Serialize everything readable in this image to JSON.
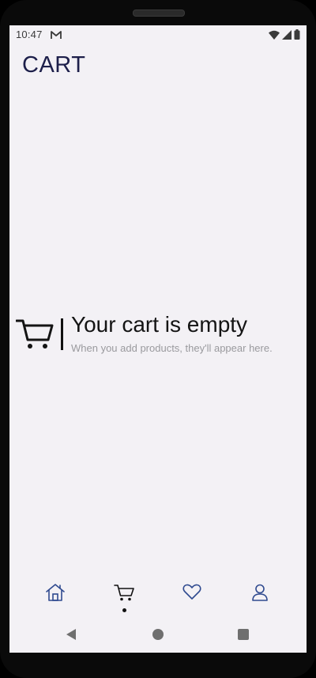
{
  "status_bar": {
    "time": "10:47",
    "icons": [
      "gmail-icon",
      "wifi-icon",
      "signal-icon",
      "battery-icon"
    ]
  },
  "header": {
    "title": "CART"
  },
  "empty_state": {
    "icon": "cart-icon",
    "title": "Your cart is empty",
    "subtitle": "When you add products, they'll appear here."
  },
  "bottom_nav": {
    "items": [
      {
        "name": "home",
        "icon": "home-icon",
        "active": false
      },
      {
        "name": "cart",
        "icon": "cart-icon",
        "active": true
      },
      {
        "name": "favorites",
        "icon": "heart-icon",
        "active": false
      },
      {
        "name": "profile",
        "icon": "person-icon",
        "active": false
      }
    ],
    "accent_color": "#2f4a8f",
    "active_color": "#111111"
  },
  "system_nav": {
    "buttons": [
      "back-icon",
      "home-circle-icon",
      "recents-icon"
    ]
  },
  "colors": {
    "screen_background": "#f3f1f5",
    "title_color": "#1d1f4a",
    "subtitle_color": "#9a9a9e"
  }
}
